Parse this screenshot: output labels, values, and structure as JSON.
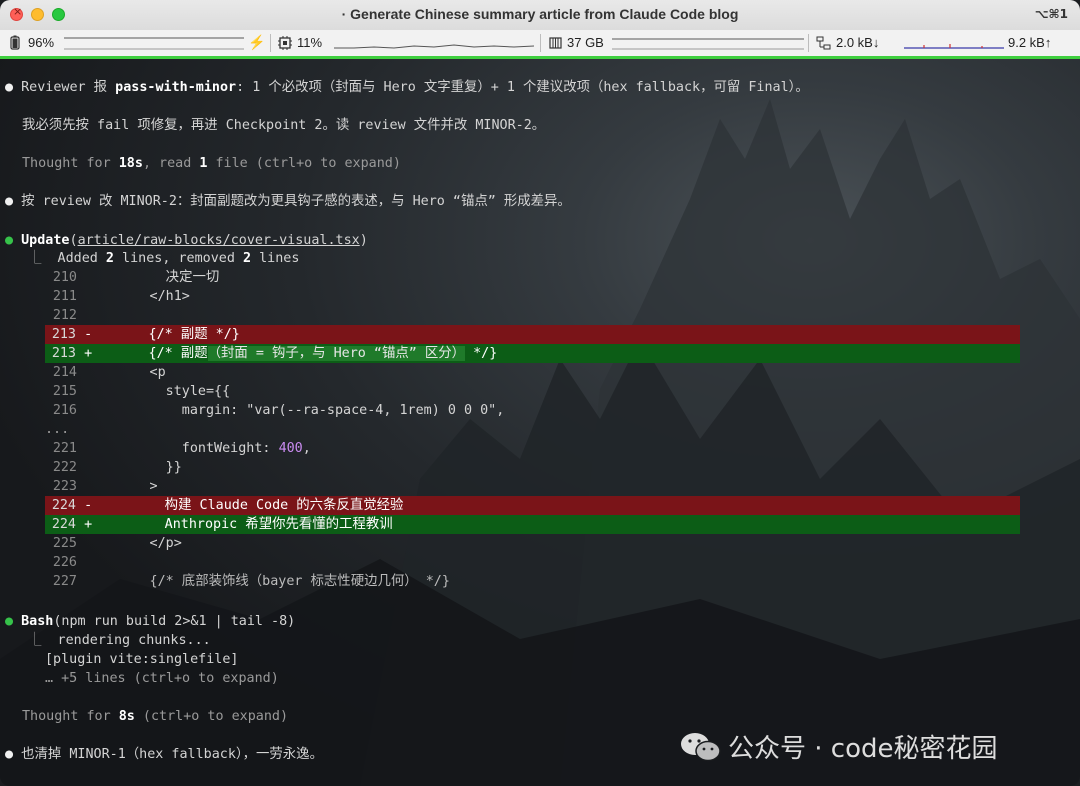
{
  "window": {
    "title": "· Generate Chinese summary article from Claude Code blog",
    "shortcut": "⌥⌘1"
  },
  "status": {
    "battery": "96%",
    "cpu": "11%",
    "memory": "37 GB",
    "net_down": "2.0 kB↓",
    "net_up": "9.2 kB↑"
  },
  "lines": {
    "l1_a": "Reviewer 报 ",
    "l1_b": "pass-with-minor",
    "l1_c": ": 1 个必改项（封面与 Hero 文字重复）+ 1 个建议改项（hex fallback，可留 Final）。",
    "l2": "我必须先按 fail 项修复，再进 Checkpoint 2。读 review 文件并改 MINOR-2。",
    "l3_a": "Thought for ",
    "l3_b": "18s",
    "l3_c": ", read ",
    "l3_d": "1",
    "l3_e": " file (ctrl+o to expand)",
    "l4": "按 review 改 MINOR-2：封面副题改为更具钩子感的表述，与 Hero “锚点” 形成差异。",
    "l5_tool": "Update",
    "l5_path": "article/raw-blocks/cover-visual.tsx",
    "l6_a": "Added ",
    "l6_b": "2",
    "l6_c": " lines, removed ",
    "l6_d": "2",
    "l6_e": " lines",
    "d210_n": "210",
    "d210": "        决定一切",
    "d211_n": "211",
    "d211": "      </h1>",
    "d212_n": "212",
    "d213r_n": "213",
    "d213r_sign": "-",
    "d213r": "      {/* 副题 */}",
    "d213a_n": "213",
    "d213a_sign": "+",
    "d213a_pre": "      {/* 副题",
    "d213a_hl": "（封面 = 钩子，与 Hero “锚点” 区分）",
    "d213a_post": " */}",
    "d214_n": "214",
    "d214": "      <p",
    "d215_n": "215",
    "d215": "        style={{",
    "d216_n": "216",
    "d216": "          margin: \"var(--ra-space-4, 1rem) 0 0 0\",",
    "ellipsis": "...",
    "d221_n": "221",
    "d221_a": "          fontWeight: ",
    "d221_b": "400",
    "d221_c": ",",
    "d222_n": "222",
    "d222": "        }}",
    "d223_n": "223",
    "d223": "      >",
    "d224r_n": "224",
    "d224r_sign": "-",
    "d224r": "        构建 Claude Code 的六条反直觉经验",
    "d224a_n": "224",
    "d224a_sign": "+",
    "d224a": "        Anthropic 希望你先看懂的工程教训",
    "d225_n": "225",
    "d225": "      </p>",
    "d226_n": "226",
    "d227_n": "227",
    "d227": "      {/* 底部装饰线（bayer 标志性硬边几何） */}",
    "l7_tool": "Bash",
    "l7_cmd": "(npm run build 2>&1 | tail -8)",
    "l8": "rendering chunks...",
    "l9": "[plugin vite:singlefile]",
    "l10": "… +5 lines (ctrl+o to expand)",
    "l11_a": "Thought for ",
    "l11_b": "8s",
    "l11_c": " (ctrl+o to expand)",
    "l12": "也清掉 MINOR-1（hex fallback），一劳永逸。"
  },
  "watermark": "公众号 · code秘密花园",
  "colors": {
    "removed_bg": "#7a1418",
    "added_bg": "#0c5d16",
    "tool_dot": "#36c24a",
    "accent_bar": "#3fcf3f"
  }
}
